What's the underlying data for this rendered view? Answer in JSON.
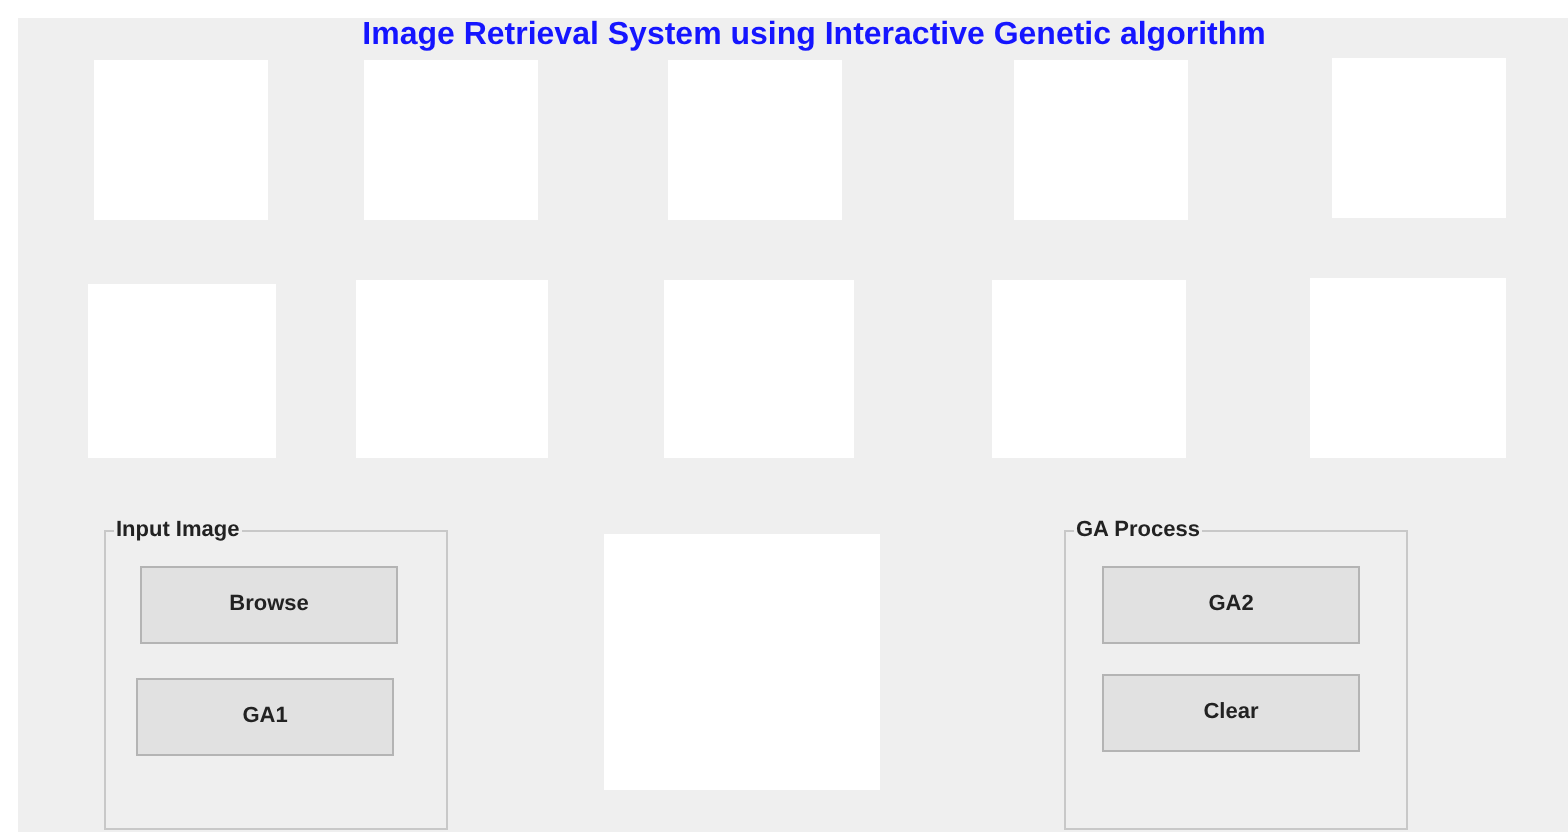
{
  "title": "Image Retrieval System using Interactive Genetic algorithm",
  "panels": [
    {
      "title": "Input Image",
      "buttons": [
        "Browse",
        "GA1"
      ]
    },
    {
      "title": "GA Process",
      "buttons": [
        "GA2",
        "Clear"
      ]
    }
  ]
}
